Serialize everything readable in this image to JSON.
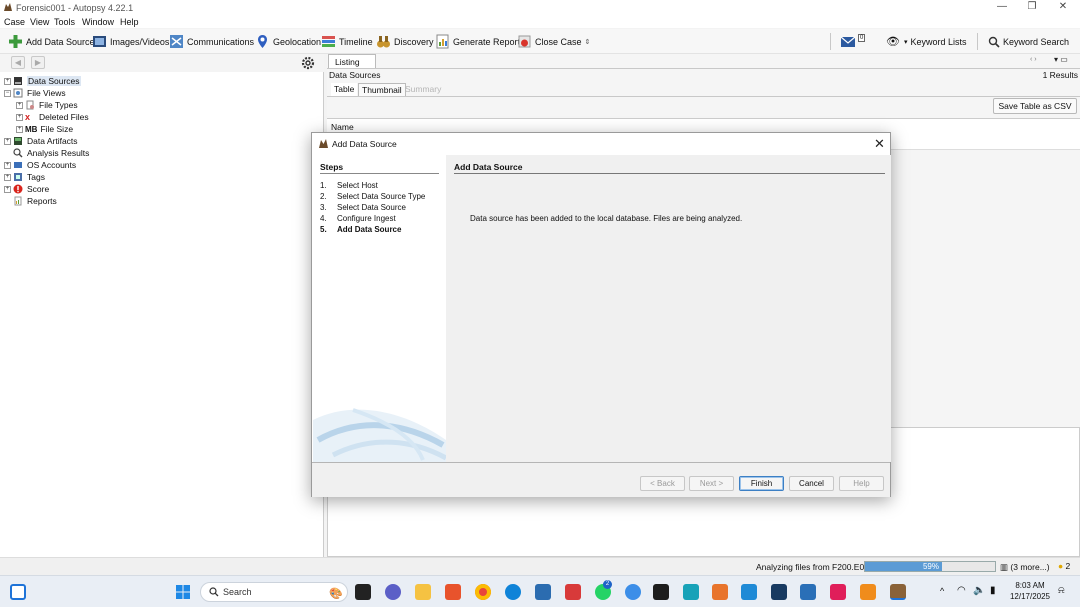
{
  "window": {
    "title": "Forensic001 - Autopsy 4.22.1",
    "controls": [
      "—",
      "❐",
      "✕"
    ]
  },
  "menu": [
    "Case",
    "View",
    "Tools",
    "Window",
    "Help"
  ],
  "toolbar": {
    "add_data_source": "Add Data Source",
    "images_videos": "Images/Videos",
    "communications": "Communications",
    "geolocation": "Geolocation",
    "timeline": "Timeline",
    "discovery": "Discovery",
    "generate_report": "Generate Report",
    "close_case": "Close Case",
    "keyword_lists": "Keyword Lists",
    "keyword_search": "Keyword Search",
    "mail_count": "0"
  },
  "tree": {
    "data_sources": "Data Sources",
    "file_views": "File Views",
    "file_types": "File Types",
    "deleted_files": "Deleted Files",
    "file_size_prefix": "MB",
    "file_size": "File Size",
    "data_artifacts": "Data Artifacts",
    "analysis_results": "Analysis Results",
    "os_accounts": "OS Accounts",
    "tags": "Tags",
    "score": "Score",
    "reports": "Reports"
  },
  "listing": {
    "tab": "Listing",
    "breadcrumb": "Data Sources",
    "results": "1  Results",
    "subtabs": [
      "Table",
      "Thumbnail",
      "Summary"
    ],
    "save_csv": "Save Table as CSV",
    "column_name": "Name"
  },
  "dialog": {
    "title": "Add Data Source",
    "steps_header": "Steps",
    "steps": [
      {
        "num": "1.",
        "label": "Select Host"
      },
      {
        "num": "2.",
        "label": "Select Data Source Type"
      },
      {
        "num": "3.",
        "label": "Select Data Source"
      },
      {
        "num": "4.",
        "label": "Configure Ingest"
      },
      {
        "num": "5.",
        "label": "Add Data Source"
      }
    ],
    "content_header": "Add Data Source",
    "message": "Data source has been added to the local database. Files are being analyzed.",
    "buttons": {
      "back": "< Back",
      "next": "Next >",
      "finish": "Finish",
      "cancel": "Cancel",
      "help": "Help"
    }
  },
  "status": {
    "text": "Analyzing files from F200.E01",
    "progress_label": "59%",
    "progress_value": 0.59,
    "more": "(3 more...)",
    "notifications": "2"
  },
  "taskbar": {
    "search_placeholder": "Search",
    "badge": "2",
    "time": "8:03 AM",
    "date": "12/17/2025"
  },
  "colors": {
    "selection": "#dde7f3",
    "progress": "#5b9bd5",
    "primary_button_border": "#3c7fc4"
  }
}
